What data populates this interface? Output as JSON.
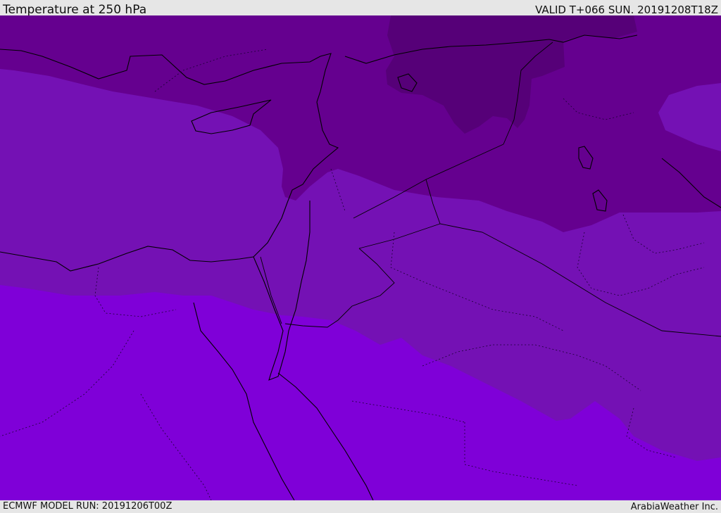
{
  "header": {
    "title": "Temperature at 250 hPa",
    "valid": "VALID T+066 SUN. 20191208T18Z"
  },
  "footer": {
    "model_run": "ECMWF MODEL RUN: 20191206T00Z",
    "credit": "ArabiaWeather Inc."
  },
  "map": {
    "colors": {
      "coldest": "#560078",
      "cold": "#65008f",
      "mid": "#7411b4",
      "warm": "#7f00d8",
      "coastline": "#000000",
      "border": "#1a0033"
    }
  }
}
